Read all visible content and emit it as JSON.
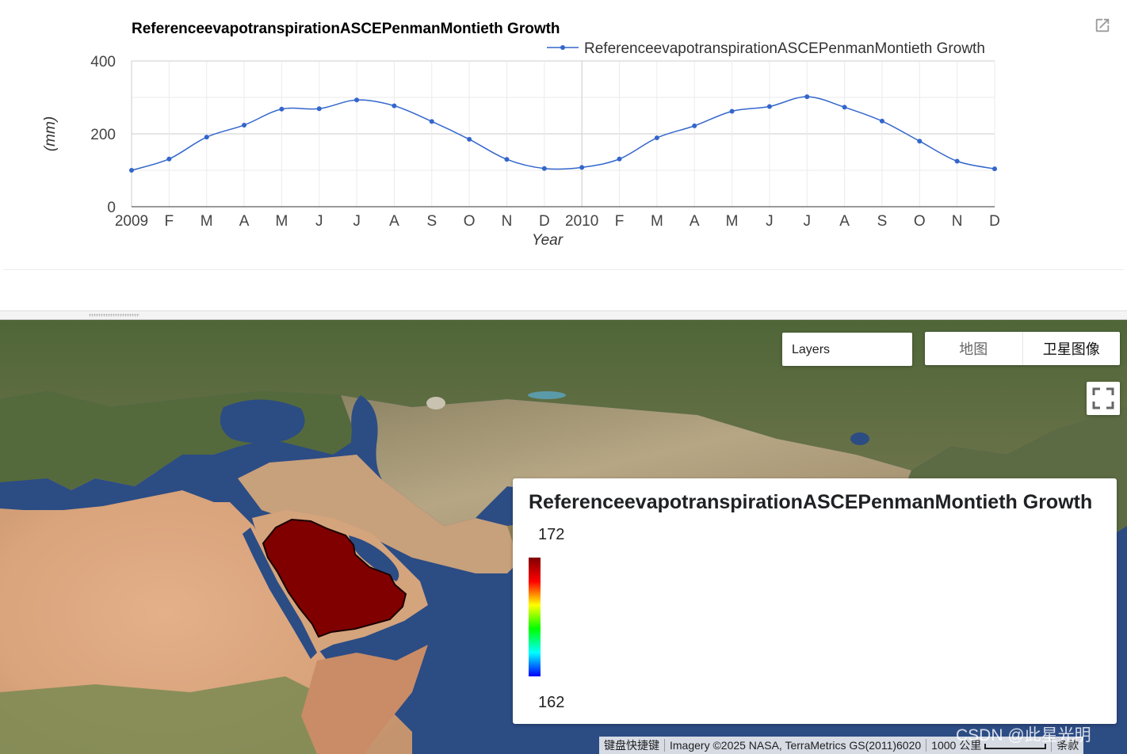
{
  "chart_data": {
    "type": "line",
    "title": "ReferenceevapotranspirationASCEPenmanMontieth Growth",
    "xlabel": "Year",
    "ylabel": "(mm)",
    "ylim": [
      0,
      400
    ],
    "y_ticks": [
      "0",
      "200",
      "400"
    ],
    "x_ticks": [
      "2009",
      "F",
      "M",
      "A",
      "M",
      "J",
      "J",
      "A",
      "S",
      "O",
      "N",
      "D",
      "2010",
      "F",
      "M",
      "A",
      "M",
      "J",
      "J",
      "A",
      "S",
      "O",
      "N",
      "D"
    ],
    "grid": true,
    "legend_position": "top-right",
    "series": [
      {
        "name": "ReferenceevapotranspirationASCEPenmanMontieth Growth",
        "color": "#3366cc",
        "x": [
          "2009-01",
          "2009-02",
          "2009-03",
          "2009-04",
          "2009-05",
          "2009-06",
          "2009-07",
          "2009-08",
          "2009-09",
          "2009-10",
          "2009-11",
          "2009-12",
          "2010-01",
          "2010-02",
          "2010-03",
          "2010-04",
          "2010-05",
          "2010-06",
          "2010-07",
          "2010-08",
          "2010-09",
          "2010-10",
          "2010-11",
          "2010-12"
        ],
        "values": [
          100,
          131,
          191,
          224,
          268,
          269,
          293,
          277,
          234,
          185,
          130,
          105,
          108,
          131,
          189,
          222,
          262,
          275,
          302,
          273,
          235,
          180,
          125,
          104
        ]
      }
    ]
  },
  "map": {
    "layers_label": "Layers",
    "map_type_map": "地图",
    "map_type_satellite": "卫星图像",
    "fullscreen_icon": "fullscreen-icon",
    "legend": {
      "title": "ReferenceevapotranspirationASCEPenmanMontieth Growth",
      "max": "172",
      "min": "162",
      "palette": [
        "#0000ff",
        "#00ffff",
        "#00ff00",
        "#ffff00",
        "#ff0000",
        "#800000"
      ]
    },
    "attribution": {
      "shortcuts": "键盘快捷键",
      "imagery": "Imagery ©2025 NASA, TerraMetrics GS(2011)6020",
      "scale": "1000 公里",
      "terms": "条款"
    },
    "watermark": "CSDN @此星光明",
    "region_color": "#800000"
  },
  "chart_panel": {
    "popout_icon": "open-in-new-icon"
  }
}
